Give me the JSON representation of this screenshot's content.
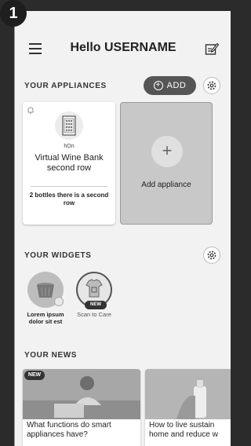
{
  "step_number": "1",
  "header": {
    "title": "Hello USERNAME",
    "menu_icon": "hamburger-icon",
    "edit_icon": "edit-note-icon"
  },
  "appliances": {
    "section_label": "YOUR APPLIANCES",
    "add_button_label": "ADD",
    "settings_icon": "gear-icon",
    "items": [
      {
        "brand": "hOn",
        "name": "Virtual Wine Bank second row",
        "status": "2 bottles there is a second row",
        "icon": "wine-cabinet-icon",
        "notification_icon": "bell-icon"
      }
    ],
    "add_card_label": "Add appliance"
  },
  "widgets": {
    "section_label": "YOUR WIDGETS",
    "settings_icon": "gear-icon",
    "items": [
      {
        "label": "Lorem ipsum dolor sit est",
        "icon": "laundry-basket-icon"
      },
      {
        "label": "Scan to Care",
        "icon": "tshirt-scan-icon",
        "badge": "NEW"
      }
    ]
  },
  "news": {
    "section_label": "YOUR NEWS",
    "items": [
      {
        "title": "What functions do smart appliances have?",
        "badge": "NEW"
      },
      {
        "title": "How to live sustain home and reduce w"
      }
    ]
  }
}
